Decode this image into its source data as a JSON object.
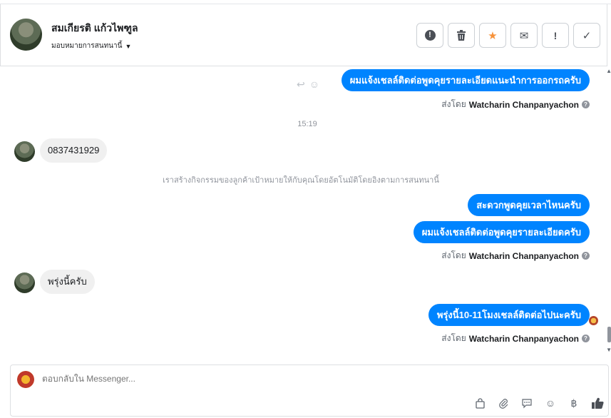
{
  "header": {
    "contact_name": "สมเกียรติ แก้วไพฑูล",
    "assign_label": "มอบหมายการสนทนานี้",
    "actions": [
      {
        "name": "alert-circle-icon",
        "glyph": "!"
      },
      {
        "name": "trash-icon",
        "glyph": "🗑"
      },
      {
        "name": "star-icon",
        "glyph": "★"
      },
      {
        "name": "envelope-icon",
        "glyph": "✉"
      },
      {
        "name": "exclamation-icon",
        "glyph": "!"
      },
      {
        "name": "checkmark-icon",
        "glyph": "✓"
      }
    ]
  },
  "thread": {
    "msg1": "ผมแจ้งเชลล์ติดต่อพูดคุยรายละเอียดแนะนำการออกรถครับ",
    "sent_by_prefix": "ส่งโดย",
    "sent_by_name": "Watcharin Chanpanyachon",
    "time1": "15:19",
    "in1": "0837431929",
    "notice": "เราสร้างกิจกรรมของลูกค้าเป้าหมายให้กับคุณโดยอัตโนมัติโดยอิงตามการสนทนานี้",
    "msg2": "สะดวกพูดคุยเวลาไหนครับ",
    "msg3": "ผมแจ้งเชลล์ติดต่อพูดคุยรายละเอียดครับ",
    "in2": "พรุ่งนี้ครับ",
    "msg4": "พรุ่งนี้10-11โมงเชลล์ติดต่อไปนะครับ"
  },
  "composer": {
    "placeholder": "ตอบกลับใน Messenger...",
    "tools": [
      "bag-icon",
      "paperclip-icon",
      "chat-bubble-icon",
      "smiley-icon",
      "baht-icon",
      "thumbs-up-icon"
    ]
  },
  "colors": {
    "accent": "#0084ff",
    "star": "#f7923a",
    "incoming_bg": "#f0f0f0"
  }
}
